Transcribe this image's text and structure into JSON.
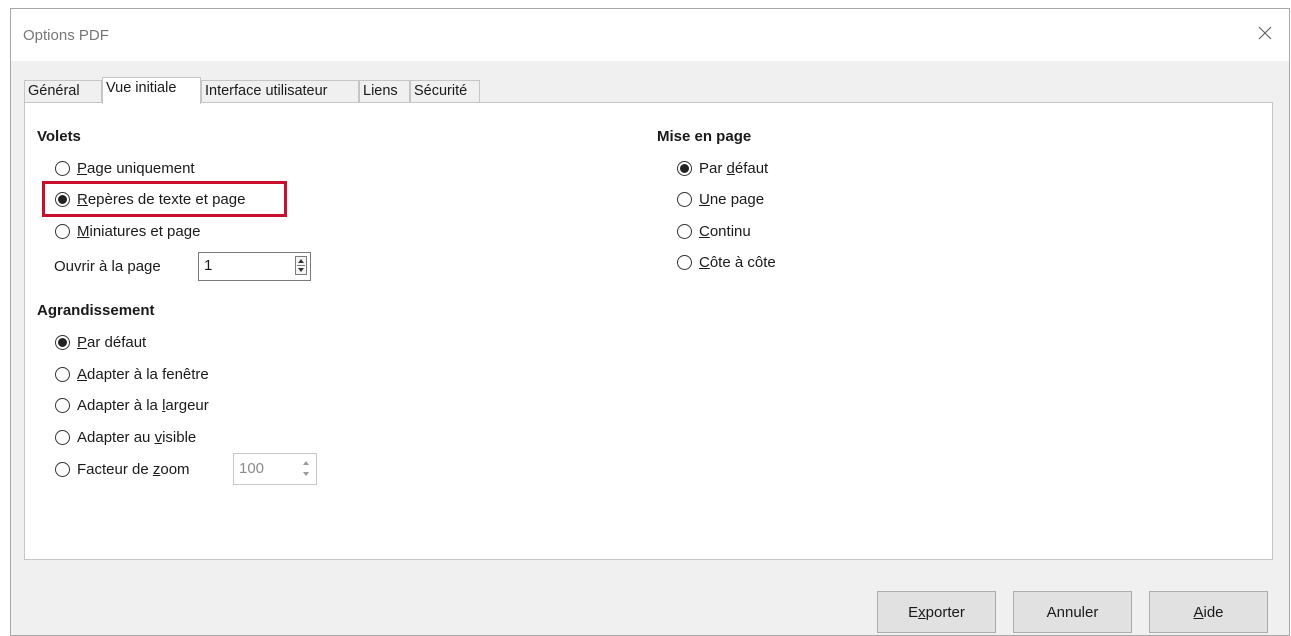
{
  "window": {
    "title": "Options PDF"
  },
  "tabs": [
    "Général",
    "Vue initiale",
    "Interface utilisateur",
    "Liens",
    "Sécurité"
  ],
  "panes": {
    "heading": "Volets",
    "options": [
      {
        "pre": "",
        "ul": "P",
        "post": "age uniquement",
        "checked": false
      },
      {
        "pre": "",
        "ul": "R",
        "post": "epères de texte et page",
        "checked": true
      },
      {
        "pre": "",
        "ul": "M",
        "post": "iniatures et page",
        "checked": false
      }
    ],
    "open_page": {
      "pre": "Ouvrir à la pa",
      "ul": "g",
      "post": "e",
      "value": "1"
    }
  },
  "magnification": {
    "heading": "Agrandissement",
    "options": [
      {
        "pre": "",
        "ul": "P",
        "post": "ar défaut",
        "checked": true
      },
      {
        "pre": "",
        "ul": "A",
        "post": "dapter à la fenêtre",
        "checked": false
      },
      {
        "pre": "Adapter à la ",
        "ul": "l",
        "post": "argeur",
        "checked": false
      },
      {
        "pre": "Adapter au ",
        "ul": "v",
        "post": "isible",
        "checked": false
      },
      {
        "pre": "Facteur de ",
        "ul": "z",
        "post": "oom",
        "checked": false
      }
    ],
    "zoom_value": "100"
  },
  "page_layout": {
    "heading": "Mise en page",
    "options": [
      {
        "pre": "Par ",
        "ul": "d",
        "post": "éfaut",
        "checked": true
      },
      {
        "pre": "",
        "ul": "U",
        "post": "ne page",
        "checked": false
      },
      {
        "pre": "",
        "ul": "C",
        "post": "ontinu",
        "checked": false
      },
      {
        "pre": "",
        "ul": "C",
        "post": "ôte à côte",
        "checked": false
      }
    ]
  },
  "buttons": {
    "export": {
      "pre": "E",
      "ul": "x",
      "post": "porter"
    },
    "cancel": {
      "pre": "Annuler",
      "ul": "",
      "post": ""
    },
    "help": {
      "pre": "",
      "ul": "A",
      "post": "ide"
    }
  },
  "colors": {
    "highlight": "#c8102e",
    "dialog_bg": "#f0f0f0",
    "panel_bg": "#ffffff"
  }
}
